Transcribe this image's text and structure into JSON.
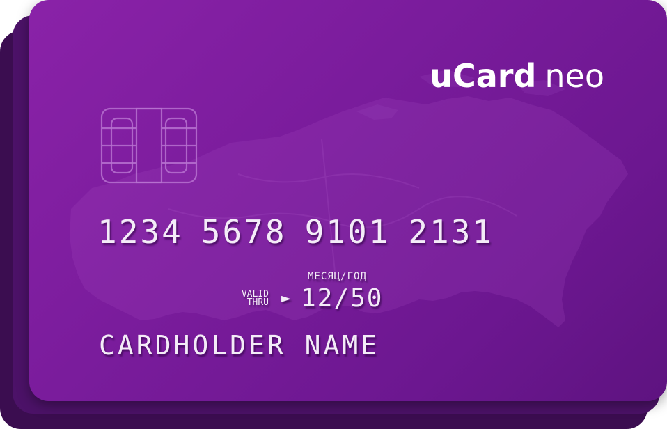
{
  "card": {
    "brand_primary": "uCard",
    "brand_secondary": "neo",
    "number_groups": [
      "1234",
      "5678",
      "9101",
      "2131"
    ],
    "month_year_label": "МЕСЯЦ/ГОД",
    "valid_line1": "VALID",
    "valid_line2": "THRU",
    "arrow": "►",
    "expiry": "12/50",
    "holder_name": "CARDHOLDER NAME"
  },
  "colors": {
    "card_base": "#7a1c9c",
    "card_back_1": "#4c1268",
    "card_back_2": "#3b0d50",
    "text": "#f4ecf8"
  },
  "icons": [
    "chip-icon",
    "map-background"
  ]
}
